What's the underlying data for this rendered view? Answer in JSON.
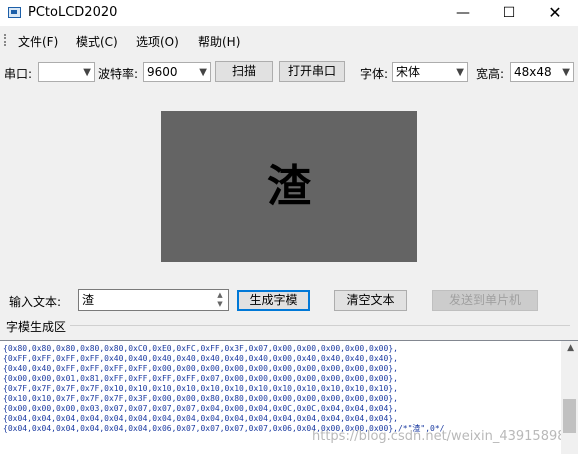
{
  "window": {
    "title": "PCtoLCD2020",
    "minimize": "—",
    "maximize": "☐",
    "close": "✕"
  },
  "menu": [
    "文件(F)",
    "模式(C)",
    "选项(O)",
    "帮助(H)"
  ],
  "toolbar": {
    "port_label": "串口:",
    "port_value": "",
    "baud_label": "波特率:",
    "baud_value": "9600",
    "scan_button": "扫描",
    "open_port_button": "打开串口",
    "font_label": "字体:",
    "font_value": "宋体",
    "size_label": "宽高:",
    "size_value": "48x48"
  },
  "preview": {
    "glyph": "渣"
  },
  "input": {
    "label": "输入文本:",
    "value": "渣",
    "generate_button": "生成字模",
    "clear_button": "清空文本",
    "send_button": "发送到单片机"
  },
  "output": {
    "section_label": "字模生成区",
    "lines": [
      "{0x80,0x80,0x80,0x80,0x80,0xC0,0xE0,0xFC,0xFF,0x3F,0x07,0x00,0x00,0x00,0x00,0x00},",
      "{0xFF,0xFF,0xFF,0xFF,0x40,0x40,0x40,0x40,0x40,0x40,0x40,0x00,0x40,0x40,0x40,0x40},",
      "{0x40,0x40,0xFF,0xFF,0xFF,0xFF,0x00,0x00,0x00,0x00,0x00,0x00,0x00,0x00,0x00,0x00},",
      "{0x00,0x00,0x01,0x81,0xFF,0xFF,0xFF,0xFF,0x07,0x00,0x00,0x00,0x00,0x00,0x00,0x00},",
      "{0x7F,0x7F,0x7F,0x7F,0x10,0x10,0x10,0x10,0x10,0x10,0x10,0x10,0x10,0x10,0x10,0x10},",
      "{0x10,0x10,0x7F,0x7F,0x7F,0x3F,0x00,0x00,0x80,0x80,0x00,0x00,0x00,0x00,0x00,0x00},",
      "{0x00,0x00,0x00,0x03,0x07,0x07,0x07,0x07,0x04,0x00,0x04,0x0C,0x0C,0x04,0x04,0x04},",
      "{0x04,0x04,0x04,0x04,0x04,0x04,0x04,0x04,0x04,0x04,0x04,0x04,0x04,0x04,0x04,0x04},",
      "{0x04,0x04,0x04,0x04,0x04,0x04,0x06,0x07,0x07,0x07,0x07,0x06,0x04,0x00,0x00,0x00},/*\"渣\",0*/"
    ],
    "watermark": "https://blog.csdn.net/weixin_43915898"
  }
}
